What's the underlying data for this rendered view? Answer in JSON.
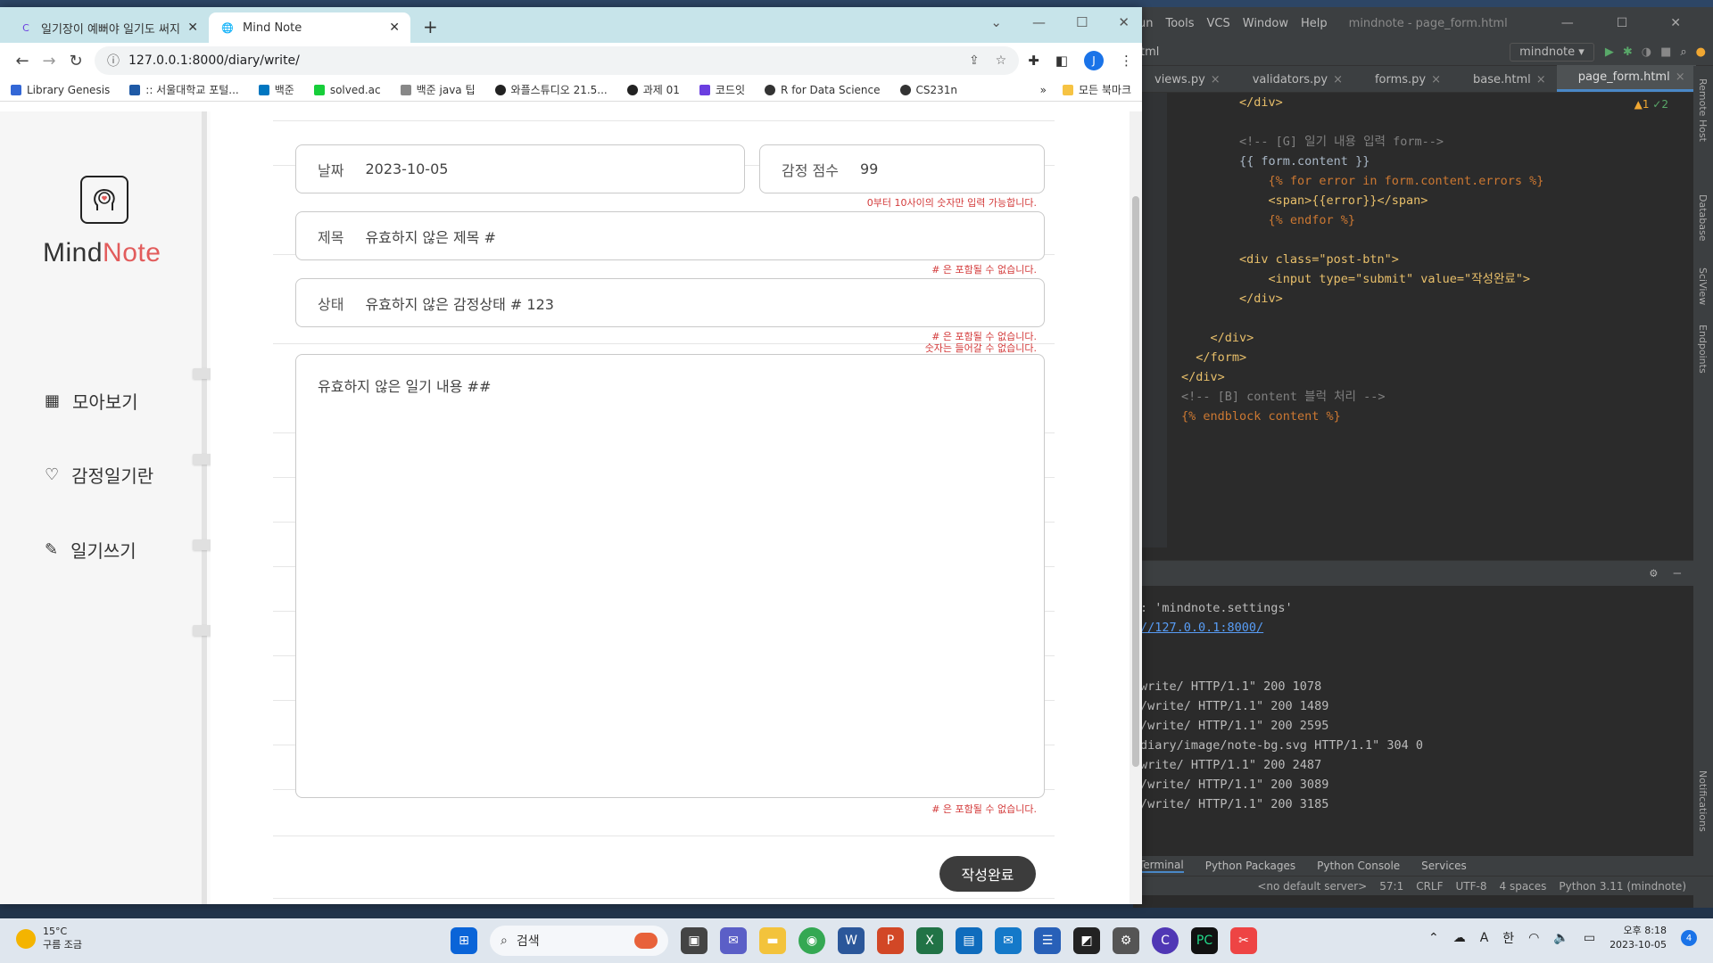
{
  "browser": {
    "tabs": [
      {
        "label": "일기장이 예뻐야 일기도 써지는",
        "active": false
      },
      {
        "label": "Mind Note",
        "active": true
      }
    ],
    "url": "127.0.0.1:8000/diary/write/",
    "profile_initial": "J",
    "bookmarks": [
      "Library Genesis",
      ":: 서울대학교 포털...",
      "백준",
      "solved.ac",
      "백준 java 팁",
      "와플스튜디오 21.5...",
      "과제 01",
      "코드잇",
      "R for Data Science",
      "CS231n"
    ],
    "bookmarks_more": "»",
    "all_bookmarks": "모든 북마크"
  },
  "app": {
    "logo_mind": "Mind",
    "logo_note": "Note",
    "nav": [
      {
        "label": "모아보기",
        "icon": "grid-icon"
      },
      {
        "label": "감정일기란",
        "icon": "heart-icon"
      },
      {
        "label": "일기쓰기",
        "icon": "pencil-icon"
      }
    ],
    "form": {
      "date_label": "날짜",
      "date_value": "2023-10-05",
      "score_label": "감정 점수",
      "score_value": "99",
      "score_error": "0부터 10사이의 숫자만 입력 가능합니다.",
      "title_label": "제목",
      "title_value": "유효하지 않은 제목 #",
      "title_error": "# 은 포함될 수 없습니다.",
      "status_label": "상태",
      "status_value": "유효하지 않은 감정상태 # 123",
      "status_error_1": "# 은 포함될 수 없습니다.",
      "status_error_2": "숫자는 들어갈 수 없습니다.",
      "content_value": "유효하지 않은 일기 내용 ##",
      "content_error": "# 은 포함될 수 없습니다.",
      "submit_label": "작성완료"
    }
  },
  "ide": {
    "menu": [
      "un",
      "Tools",
      "VCS",
      "Window",
      "Help"
    ],
    "title": "mindnote - page_form.html",
    "breadcrumb": "tml",
    "run_config": "mindnote",
    "tabs": [
      "views.py",
      "validators.py",
      "forms.py",
      "base.html",
      "page_form.html"
    ],
    "active_tab": "page_form.html",
    "inspection_warnings": "▲1",
    "inspection_ok": "✓2",
    "code_lines": [
      "        </div>",
      "",
      "        <!-- [G] 일기 내용 입력 form-->",
      "        {{ form.content }}",
      "            {% for error in form.content.errors %}",
      "            <span>{{error}}</span>",
      "            {% endfor %}",
      "",
      "        <div class=\"post-btn\">",
      "            <input type=\"submit\" value=\"작성완료\">",
      "        </div>",
      "",
      "    </div>",
      "  </form>",
      "</div>",
      "<!-- [B] content 블럭 처리 -->",
      "{% endblock content %}"
    ],
    "right_tools": [
      "Remote Host",
      "Database",
      "SciView",
      "Endpoints",
      "Notifications"
    ],
    "terminal_lines": [
      ": 'mindnote.settings'",
      "//127.0.0.1:8000/",
      "",
      "",
      "write/ HTTP/1.1\" 200 1078",
      "/write/ HTTP/1.1\" 200 1489",
      "/write/ HTTP/1.1\" 200 2595",
      "diary/image/note-bg.svg HTTP/1.1\" 304 0",
      "write/ HTTP/1.1\" 200 2487",
      "/write/ HTTP/1.1\" 200 3089",
      "/write/ HTTP/1.1\" 200 3185"
    ],
    "bottom_tabs": [
      "Terminal",
      "Python Packages",
      "Python Console",
      "Services"
    ],
    "status": [
      "<no default server>",
      "57:1",
      "CRLF",
      "UTF-8",
      "4 spaces",
      "Python 3.11 (mindnote)"
    ]
  },
  "taskbar": {
    "temperature": "15°C",
    "weather": "구름 조금",
    "search_placeholder": "검색",
    "tray_lang_a": "A",
    "tray_lang_k": "한",
    "time": "오후 8:18",
    "date": "2023-10-05",
    "notification_count": "4"
  }
}
